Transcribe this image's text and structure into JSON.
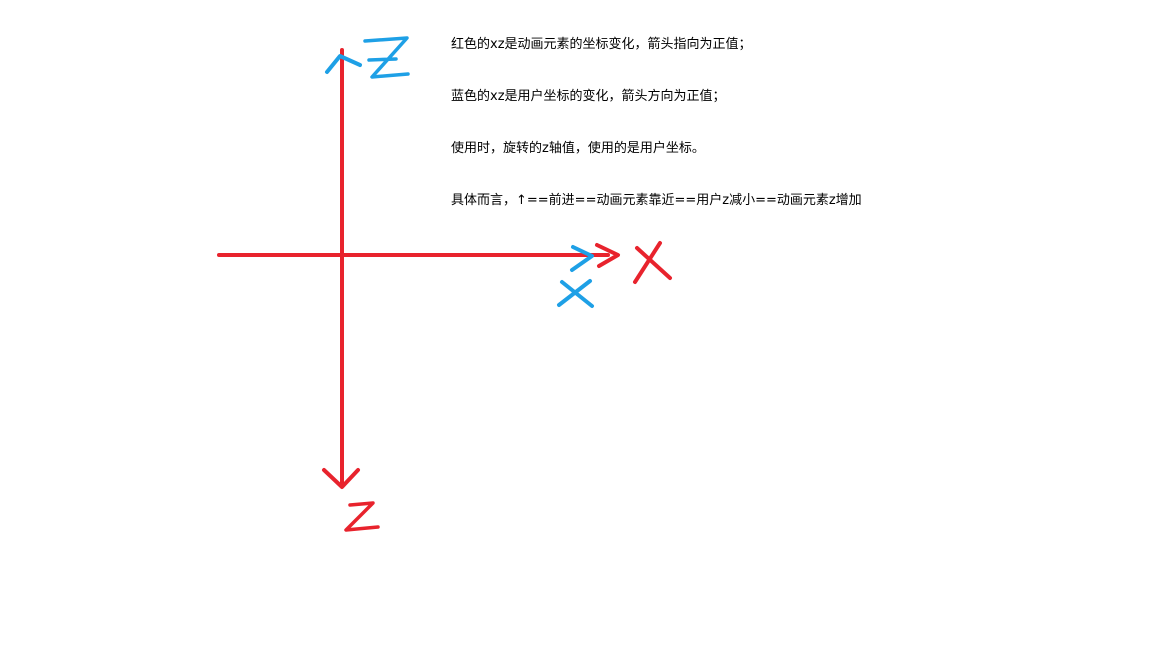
{
  "colors": {
    "element_axis": "#e8232d",
    "user_axis": "#1ea0e6",
    "text": "#000000",
    "background": "#ffffff"
  },
  "axes": {
    "element_x_label": "X",
    "element_z_label": "Z",
    "user_x_label": "X",
    "user_z_label": "Z"
  },
  "notes": [
    "红色的xz是动画元素的坐标变化，箭头指向为正值；",
    "蓝色的xz是用户坐标的变化，箭头方向为正值；",
    "使用时，旋转的z轴值，使用的是用户坐标。",
    "具体而言，↑==前进==动画元素靠近==用户z减小==动画元素z增加"
  ]
}
